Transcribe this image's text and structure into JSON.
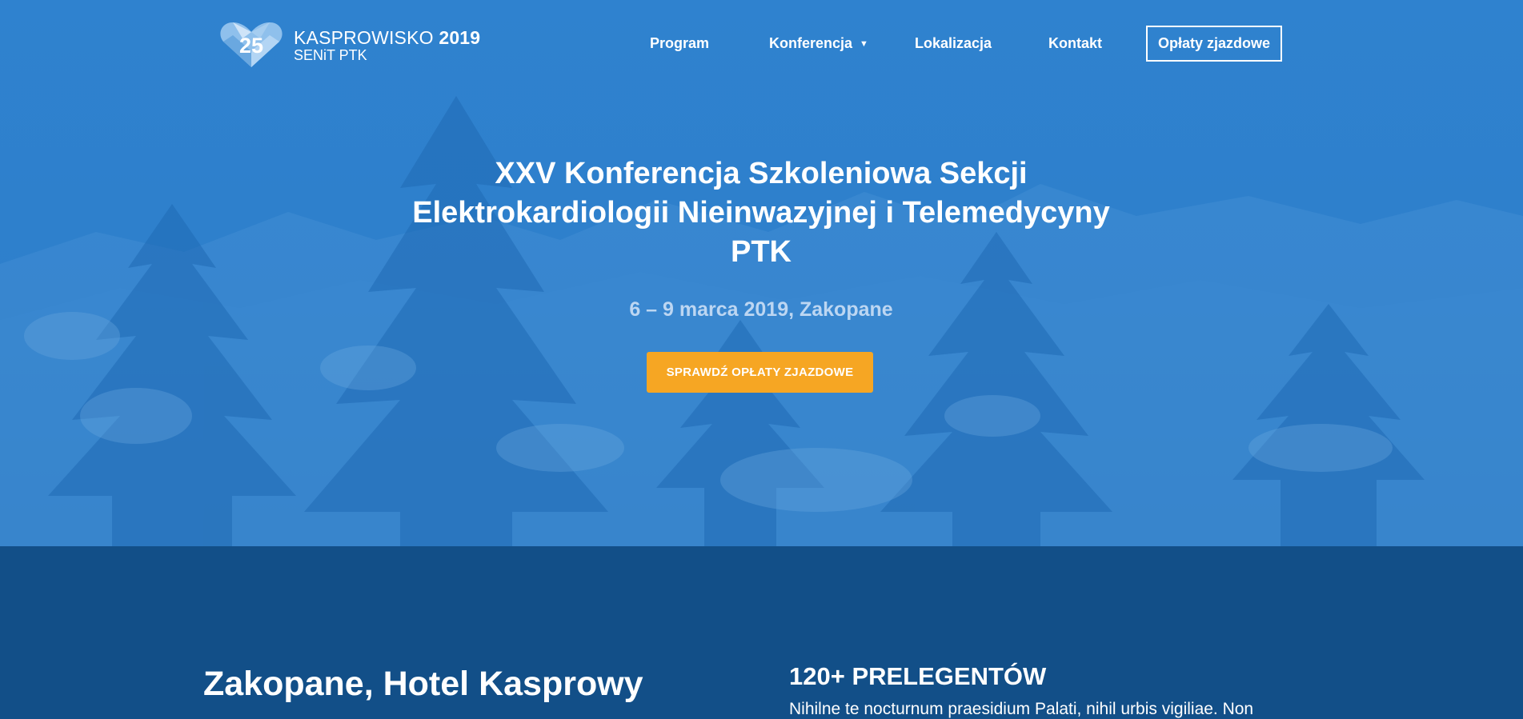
{
  "brand": {
    "badge_number": "25",
    "title_light": "KASPROWISKO",
    "title_bold": "2019",
    "subtitle": "SENiT PTK"
  },
  "nav": {
    "items": [
      {
        "label": "Program"
      },
      {
        "label": "Konferencja",
        "has_dropdown": true
      },
      {
        "label": "Lokalizacja"
      },
      {
        "label": "Kontakt"
      }
    ],
    "button_label": "Opłaty zjazdowe",
    "caret_icon": "caret-down-icon"
  },
  "hero": {
    "title_lines": [
      "XXV Konferencja Szkoleniowa Sekcji",
      "Elektrokardiologii Nieinwazyjnej i Telemedycyny",
      "PTK"
    ],
    "date": "6 – 9 marca 2019, Zakopane",
    "cta_label": "SPRAWDŹ OPŁATY ZJAZDOWE"
  },
  "info": {
    "left_title": "Zakopane, Hotel Kasprowy",
    "right_title": "120+ PRELEGENTÓW",
    "right_text": "Nihilne te nocturnum praesidium Palati, nihil urbis vigiliae. Non"
  },
  "colors": {
    "hero_blue": "#2f82cf",
    "section_navy": "#124f88",
    "cta_orange": "#f6a623",
    "date_lightblue": "#bcd6f2"
  }
}
